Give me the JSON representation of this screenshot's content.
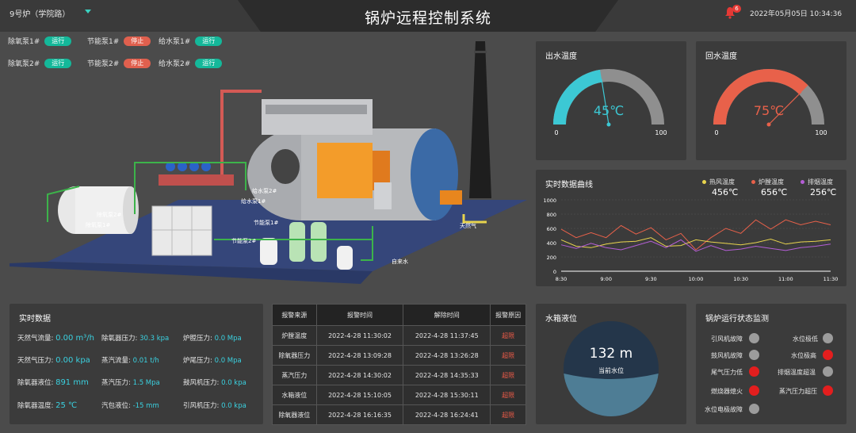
{
  "header": {
    "station": "9号炉（学院路）",
    "title": "锅炉远程控制系统",
    "alarm_count": "6",
    "datetime": "2022年05月05日 10:34:36"
  },
  "pumps": [
    {
      "label": "除氧泵1#",
      "state": "运行",
      "status": "on"
    },
    {
      "label": "节能泵1#",
      "state": "停止",
      "status": "off"
    },
    {
      "label": "给水泵1#",
      "state": "运行",
      "status": "on"
    },
    {
      "label": "除氧泵2#",
      "state": "运行",
      "status": "on"
    },
    {
      "label": "节能泵2#",
      "state": "停止",
      "status": "off"
    },
    {
      "label": "给水泵2#",
      "state": "运行",
      "status": "on"
    }
  ],
  "scene_labels": {
    "deaerator_pump2": "除氧泵2#",
    "deaerator_pump1": "除氧泵1#",
    "feed_pump2": "给水泵2#",
    "feed_pump1": "给水泵1#",
    "economizer_pump1": "节能泵1#",
    "economizer_pump2": "节能泵2#",
    "natural_gas": "天然气",
    "tap_water": "自来水"
  },
  "gauges": [
    {
      "title": "出水温度",
      "value": 45,
      "display": "45℃",
      "min": "0",
      "max": "100",
      "color": "#3cc8d4"
    },
    {
      "title": "回水温度",
      "value": 75,
      "display": "75℃",
      "min": "0",
      "max": "100",
      "color": "#e8614a"
    }
  ],
  "chart_panel": {
    "title": "实时数据曲线",
    "legend": [
      {
        "name": "热风温度",
        "value": "456℃",
        "color": "#e8d44d"
      },
      {
        "name": "炉膛温度",
        "value": "656℃",
        "color": "#e8614a"
      },
      {
        "name": "排烟温度",
        "value": "256℃",
        "color": "#b45ed6"
      }
    ]
  },
  "chart_data": {
    "type": "line",
    "title": "实时数据曲线",
    "x_ticks": [
      "8:30",
      "9:00",
      "9:30",
      "10:00",
      "10:30",
      "11:00",
      "11:30"
    ],
    "x": [
      8.5,
      8.667,
      8.833,
      9.0,
      9.167,
      9.333,
      9.5,
      9.667,
      9.833,
      10.0,
      10.167,
      10.333,
      10.5,
      10.667,
      10.833,
      11.0,
      11.167,
      11.333,
      11.5
    ],
    "ylim": [
      0,
      1000
    ],
    "y_ticks": [
      "0",
      "200",
      "400",
      "600",
      "800",
      "1000"
    ],
    "series": [
      {
        "name": "炉膛温度",
        "color": "#e8614a",
        "values": [
          590,
          470,
          540,
          470,
          640,
          520,
          610,
          440,
          530,
          300,
          470,
          600,
          530,
          720,
          590,
          720,
          650,
          700,
          650
        ]
      },
      {
        "name": "热风温度",
        "color": "#e8d44d",
        "values": [
          440,
          350,
          330,
          380,
          410,
          420,
          470,
          350,
          360,
          440,
          410,
          390,
          370,
          400,
          450,
          380,
          410,
          420,
          440
        ]
      },
      {
        "name": "排烟温度",
        "color": "#b45ed6",
        "values": [
          370,
          320,
          390,
          330,
          300,
          360,
          420,
          330,
          440,
          280,
          360,
          290,
          310,
          350,
          320,
          290,
          330,
          350,
          380
        ]
      }
    ]
  },
  "realtime": {
    "title": "实时数据",
    "rows": [
      [
        {
          "label": "天然气流量:",
          "value": "0.00 m³/h"
        },
        {
          "label": "除氧器压力:",
          "value": "30.3 kpa"
        },
        {
          "label": "炉膛压力:",
          "value": "0.0 Mpa"
        }
      ],
      [
        {
          "label": "天然气压力:",
          "value": "0.00 kpa"
        },
        {
          "label": "蒸汽流量:",
          "value": "0.01 t/h"
        },
        {
          "label": "炉尾压力:",
          "value": "0.0 Mpa"
        }
      ],
      [
        {
          "label": "除氧器液位:",
          "value": "891 mm"
        },
        {
          "label": "蒸汽压力:",
          "value": "1.5 Mpa"
        },
        {
          "label": "鼓风机压力:",
          "value": "0.0 kpa"
        }
      ],
      [
        {
          "label": "除氧器温度:",
          "value": "25 ℃"
        },
        {
          "label": "汽包液位:",
          "value": "-15 mm"
        },
        {
          "label": "引风机压力:",
          "value": "0.0 kpa"
        }
      ]
    ]
  },
  "alarm_table": {
    "headers": [
      "报警来源",
      "报警时间",
      "解除时间",
      "报警原因"
    ],
    "rows": [
      [
        "炉膛温度",
        "2022-4-28 11:30:02",
        "2022-4-28 11:37:45",
        "超限"
      ],
      [
        "除氧器压力",
        "2022-4-28 13:09:28",
        "2022-4-28 13:26:28",
        "超限"
      ],
      [
        "蒸汽压力",
        "2022-4-28 14:30:02",
        "2022-4-28 14:35:33",
        "超限"
      ],
      [
        "水箱液位",
        "2022-4-28 15:10:05",
        "2022-4-28 15:30:11",
        "超限"
      ],
      [
        "除氧器液位",
        "2022-4-28 16:16:35",
        "2022-4-28 16:24:41",
        "超限"
      ]
    ]
  },
  "tank": {
    "title": "水箱液位",
    "value": "132 m",
    "label": "当前水位",
    "fill_fraction": 0.45
  },
  "status_panel": {
    "title": "锅炉运行状态监测",
    "items": [
      {
        "label": "引风机故障",
        "state": "gray"
      },
      {
        "label": "水位极低",
        "state": "gray"
      },
      {
        "label": "鼓风机故障",
        "state": "gray"
      },
      {
        "label": "水位极高",
        "state": "red"
      },
      {
        "label": "尾气压力低",
        "state": "red"
      },
      {
        "label": "排烟温度超温",
        "state": "gray"
      },
      {
        "label": "燃烧器熄火",
        "state": "red"
      },
      {
        "label": "蒸汽压力超压",
        "state": "red"
      },
      {
        "label": "水位电极故障",
        "state": "gray"
      }
    ]
  }
}
